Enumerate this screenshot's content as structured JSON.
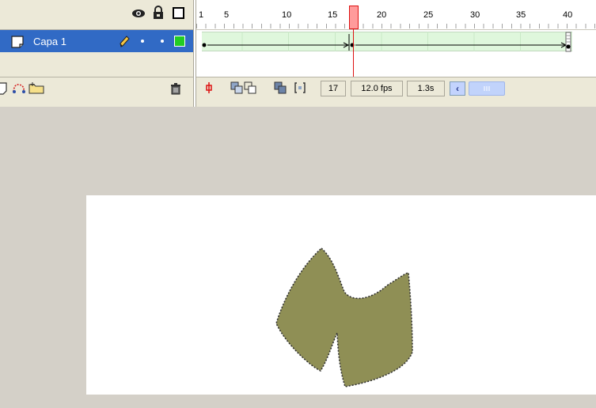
{
  "layer": {
    "name": "Capa 1"
  },
  "ruler": {
    "labels": [
      "1",
      "5",
      "10",
      "15",
      "20",
      "25",
      "30",
      "35",
      "40"
    ]
  },
  "status": {
    "current_frame": "17",
    "frame_rate": "12.0 fps",
    "elapsed_time": "1.3s"
  },
  "icons": {
    "eye": "eye-icon",
    "lock": "lock-icon",
    "outline": "outline-square-icon",
    "pencil": "pencil-icon",
    "trash": "trash-icon"
  },
  "colors": {
    "layer_selected": "#316ac5",
    "tween_fill": "#dff7dc",
    "playhead": "#dd1111",
    "shape_fill": "#8f8f55",
    "outline_color": "#22cc22"
  }
}
